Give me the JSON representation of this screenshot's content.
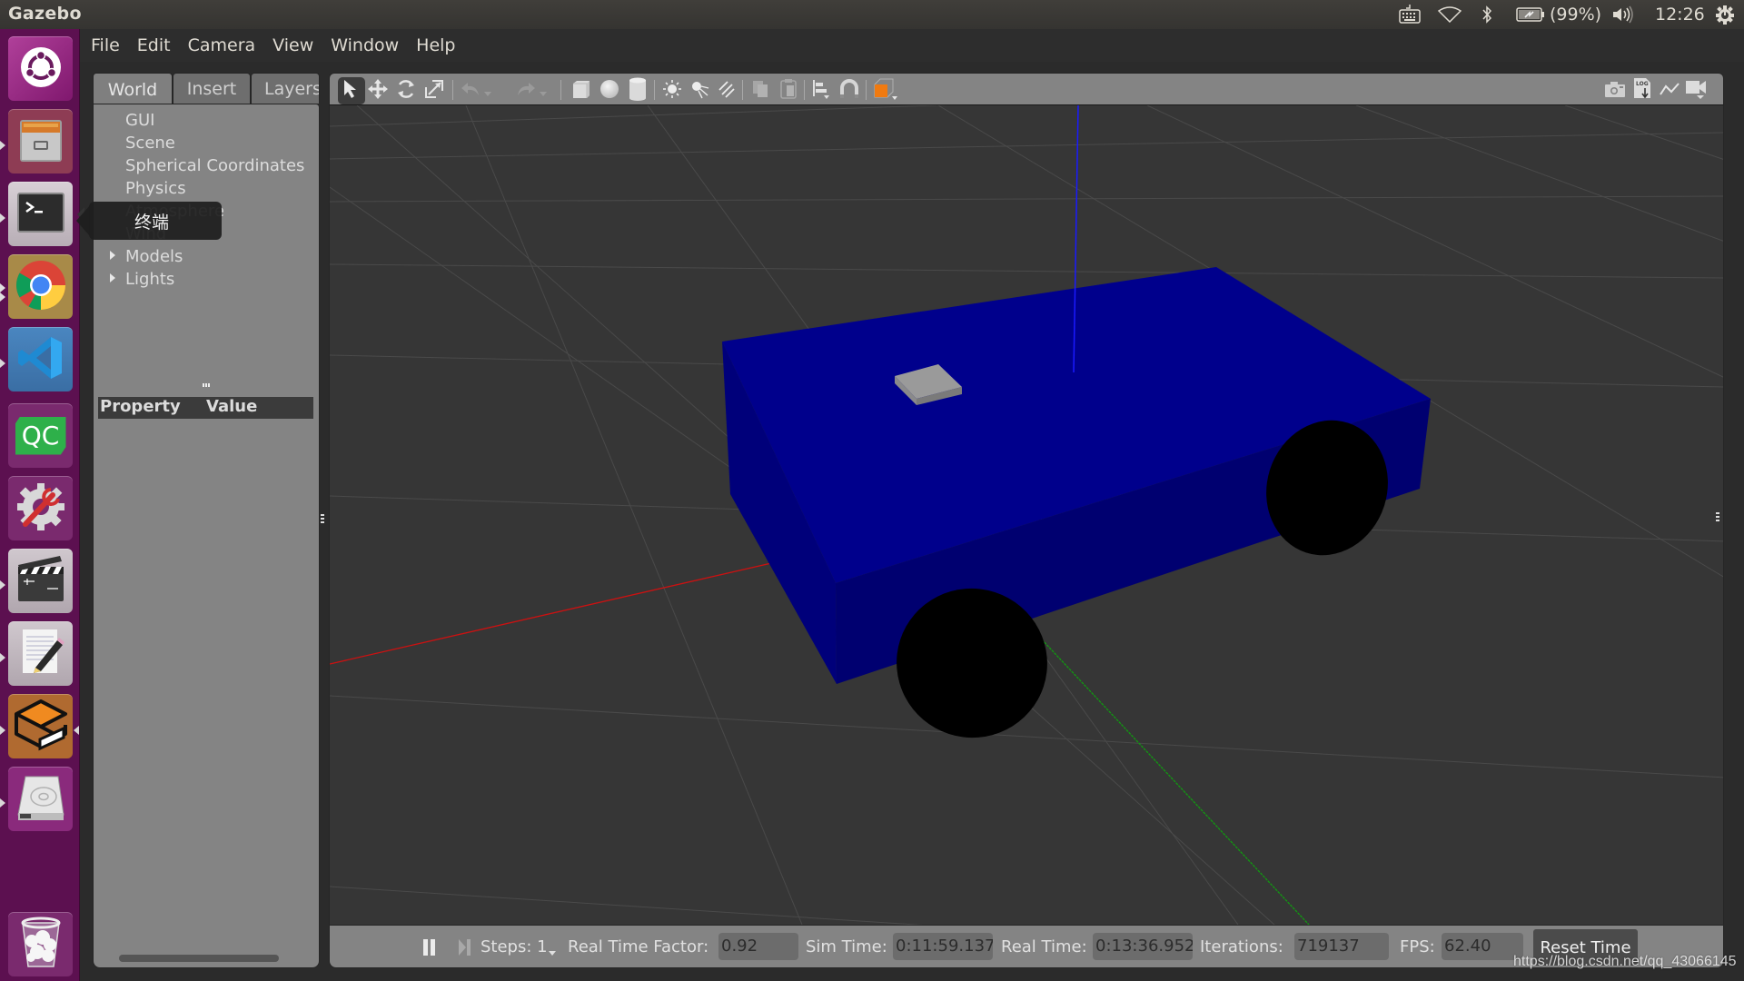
{
  "top_panel": {
    "app_title": "Gazebo",
    "battery_text": "(99%)",
    "clock": "12:26",
    "icons": [
      "keyboard-icon",
      "wifi-icon",
      "bluetooth-icon",
      "battery-charging-icon",
      "volume-icon",
      "power-gear-icon"
    ]
  },
  "launcher": {
    "items": [
      {
        "name": "ubuntu-dash",
        "icon": "ubuntu-logo-icon"
      },
      {
        "name": "files",
        "icon": "file-cabinet-icon"
      },
      {
        "name": "terminal",
        "icon": "terminal-icon"
      },
      {
        "name": "chrome",
        "icon": "chrome-icon"
      },
      {
        "name": "vscode",
        "icon": "vscode-icon"
      },
      {
        "name": "qtcreator",
        "icon": "qtcreator-icon",
        "label": "QC"
      },
      {
        "name": "system-settings",
        "icon": "settings-wrench-icon"
      },
      {
        "name": "video-editor",
        "icon": "clapperboard-icon"
      },
      {
        "name": "text-editor",
        "icon": "text-editor-icon"
      },
      {
        "name": "gazebo",
        "icon": "gazebo-icon"
      },
      {
        "name": "disk",
        "icon": "hard-disk-icon"
      },
      {
        "name": "trash",
        "icon": "trash-icon"
      }
    ],
    "tooltip": "终端"
  },
  "menubar": {
    "items": [
      "File",
      "Edit",
      "Camera",
      "View",
      "Window",
      "Help"
    ]
  },
  "left_panel": {
    "tabs": [
      "World",
      "Insert",
      "Layers"
    ],
    "active_tab": "World",
    "tree": [
      "GUI",
      "Scene",
      "Spherical Coordinates",
      "Physics",
      "Atmosphere",
      "Wind",
      "Models",
      "Lights"
    ],
    "expandable": [
      "Models",
      "Lights"
    ],
    "property_header": {
      "property": "Property",
      "value": "Value"
    }
  },
  "toolbar": {
    "tools": [
      "select-mode",
      "translate-mode",
      "rotate-mode",
      "scale-mode",
      "undo",
      "undo-history",
      "redo",
      "redo-history",
      "box-shape",
      "sphere-shape",
      "cylinder-shape",
      "point-light",
      "spot-light",
      "directional-light",
      "copy",
      "paste",
      "align",
      "snap",
      "view-angle"
    ],
    "right_tools": [
      "screenshot",
      "log-data",
      "plot",
      "record-video"
    ],
    "active_tool": "select-mode",
    "accent_color": "#f07a10"
  },
  "scene": {
    "background_color": "#363636",
    "model_color": "#00008c",
    "wheel_color": "#000000",
    "sensor_color": "#9a9a9a",
    "x_axis_color": "#cc1111",
    "y_axis_color": "#119911",
    "z_axis_color": "#1a1aff"
  },
  "bottom_bar": {
    "steps_label": "Steps: 1",
    "rtf_label": "Real Time Factor:",
    "rtf_value": "0.92",
    "sim_time_label": "Sim Time:",
    "sim_time_value": "0:11:59.137",
    "real_time_label": "Real Time:",
    "real_time_value": "0:13:36.952",
    "iterations_label": "Iterations:",
    "iterations_value": "719137",
    "fps_label": "FPS:",
    "fps_value": "62.40",
    "reset_label": "Reset Time"
  },
  "watermark": "https://blog.csdn.net/qq_43066145"
}
